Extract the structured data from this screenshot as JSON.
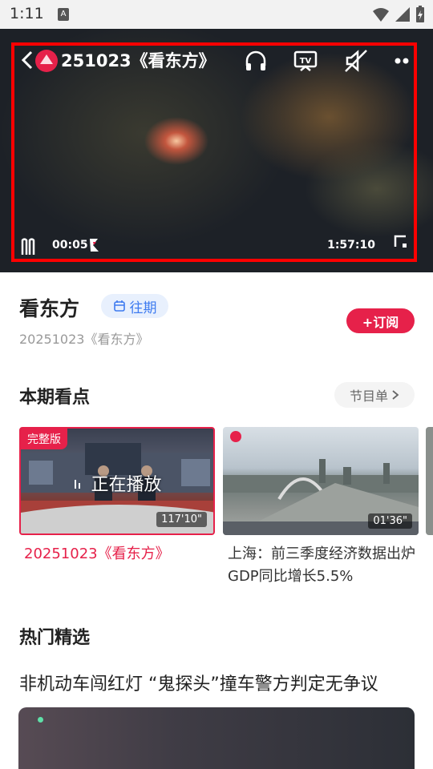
{
  "status_bar": {
    "time": "1:11",
    "notif": "A"
  },
  "player": {
    "title": "251023《看东方》",
    "current_time": "00:05",
    "duration": "1:57:10",
    "icons": [
      "back-icon",
      "logo-icon",
      "headphones-icon",
      "tv-cast-icon",
      "mute-icon",
      "more-icon",
      "pause-icon",
      "fullscreen-icon"
    ]
  },
  "program": {
    "name": "看东方",
    "past_label": "往期",
    "subtitle": "20251023《看东方》",
    "subscribe_label": "+订阅"
  },
  "highlights": {
    "title": "本期看点",
    "list_label": "节目单",
    "cards": [
      {
        "tag": "完整版",
        "playing": "正在播放",
        "duration": "117'10\"",
        "title": "20251023《看东方》"
      },
      {
        "duration": "01'36\"",
        "title": "上海：前三季度经济数据出炉 GDP同比增长5.5%"
      }
    ]
  },
  "hot": {
    "title": "热门精选",
    "items": [
      {
        "title": "非机动车闯红灯 “鬼探头”撞车警方判定无争议"
      }
    ]
  },
  "colors": {
    "accent": "#e6214a",
    "past_tag": "#3e7bf0",
    "frame": "#ff0000"
  }
}
